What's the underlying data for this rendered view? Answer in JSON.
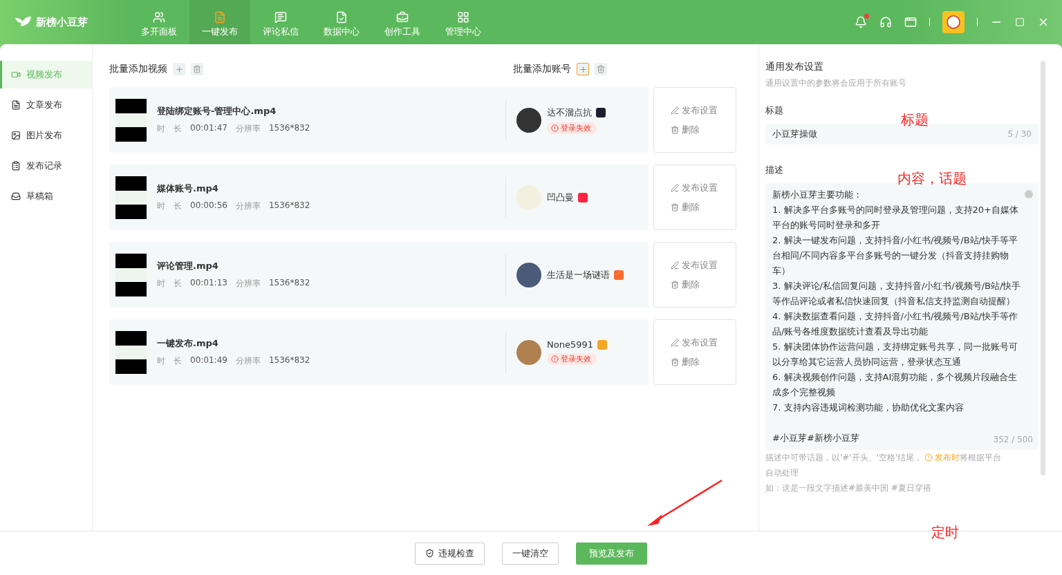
{
  "app": {
    "name": "新榜小豆芽"
  },
  "nav": [
    {
      "label": "多开面板",
      "selected": false
    },
    {
      "label": "一键发布",
      "selected": true
    },
    {
      "label": "评论私信",
      "selected": false
    },
    {
      "label": "数据中心",
      "selected": false
    },
    {
      "label": "创作工具",
      "selected": false
    },
    {
      "label": "管理中心",
      "selected": false
    }
  ],
  "header": {
    "notification_unread": true
  },
  "sidebar": {
    "items": [
      {
        "label": "视频发布",
        "selected": true
      },
      {
        "label": "文章发布",
        "selected": false
      },
      {
        "label": "图片发布",
        "selected": false
      },
      {
        "label": "发布记录",
        "selected": false
      },
      {
        "label": "草稿箱",
        "selected": false
      }
    ]
  },
  "videos_header": {
    "label": "批量添加视频"
  },
  "accounts_header": {
    "label": "批量添加账号"
  },
  "rows": [
    {
      "file": "登陆绑定账号-管理中心.mp4",
      "duration_label": "时　长",
      "duration": "00:01:47",
      "resolution_label": "分辨率",
      "resolution": "1536*832",
      "account": "达不溜点抗",
      "color": "#1f1f2e",
      "status": "登录失效",
      "actions": [
        "发布设置",
        "删除"
      ]
    },
    {
      "file": "媒体账号.mp4",
      "duration_label": "时　长",
      "duration": "00:00:56",
      "resolution_label": "分辨率",
      "resolution": "1536*832",
      "account": "凹凸曼",
      "color": "#ff2442",
      "actions": [
        "发布设置",
        "删除"
      ]
    },
    {
      "file": "评论管理.mp4",
      "duration_label": "时　长",
      "duration": "00:01:13",
      "resolution_label": "分辨率",
      "resolution": "1536*832",
      "account": "生活是一场谜语",
      "color": "#fa6b31",
      "actions": [
        "发布设置",
        "删除"
      ]
    },
    {
      "file": "一键发布.mp4",
      "duration_label": "时　长",
      "duration": "00:01:49",
      "resolution_label": "分辨率",
      "resolution": "1536*832",
      "account": "None5991",
      "color": "#f5a623",
      "status": "登录失效",
      "actions": [
        "发布设置",
        "删除"
      ]
    }
  ],
  "settings": {
    "title": "通用发布设置",
    "subtitle": "通用设置中的参数将会应用于所有账号",
    "title_field": {
      "label": "标题",
      "value": "小豆芽操做",
      "count": "5 / 30"
    },
    "description_field": {
      "label": "描述",
      "lines": [
        "新榜小豆芽主要功能：",
        "1. 解决多平台多账号的同时登录及管理问题，支持20+自媒体平台的账号同时登录和多开",
        "2. 解决一键发布问题，支持抖音/小红书/视频号/B站/快手等平台相同/不同内容多平台多账号的一键分发（抖音支持挂购物车）",
        "3. 解决评论/私信回复问题，支持抖音/小红书/视频号/B站/快手等作品评论或者私信快速回复（抖音私信支持监测自动提醒）",
        "4. 解决数据查看问题，支持抖音/小红书/视频号/B站/快手等作品/账号各维度数据统计查看及导出功能",
        "5. 解决团体协作运营问题，支持绑定账号共享，同一批账号可以分享给其它运营人员协同运营，登录状态互通",
        "6. 解决视频创作问题，支持AI混剪功能，多个视频片段融合生成多个完整视频",
        "7. 支持内容违规词检测功能，协助优化文案内容"
      ],
      "topics": "#小豆芽#新榜小豆芽",
      "count": "352 / 500"
    },
    "hint_before": "描述中可带话题，以'#'开头、'空格'结尾，",
    "hint_highlight": "发布时",
    "hint_after": "将根据平台",
    "hint_continued": "自动处理",
    "example": "如：这是一段文字描述#最美中国 #夏日穿搭"
  },
  "footer": {
    "buttons": [
      {
        "label": "违规检查",
        "kind": "check"
      },
      {
        "label": "一键清空",
        "kind": "plain"
      },
      {
        "label": "预览及发布",
        "kind": "primary"
      }
    ]
  },
  "annotations": [
    {
      "text": "标题",
      "kind": "text"
    },
    {
      "text": "内容，话题",
      "kind": "text"
    },
    {
      "text": "定时",
      "kind": "text"
    },
    {
      "kind": "arrow"
    }
  ]
}
